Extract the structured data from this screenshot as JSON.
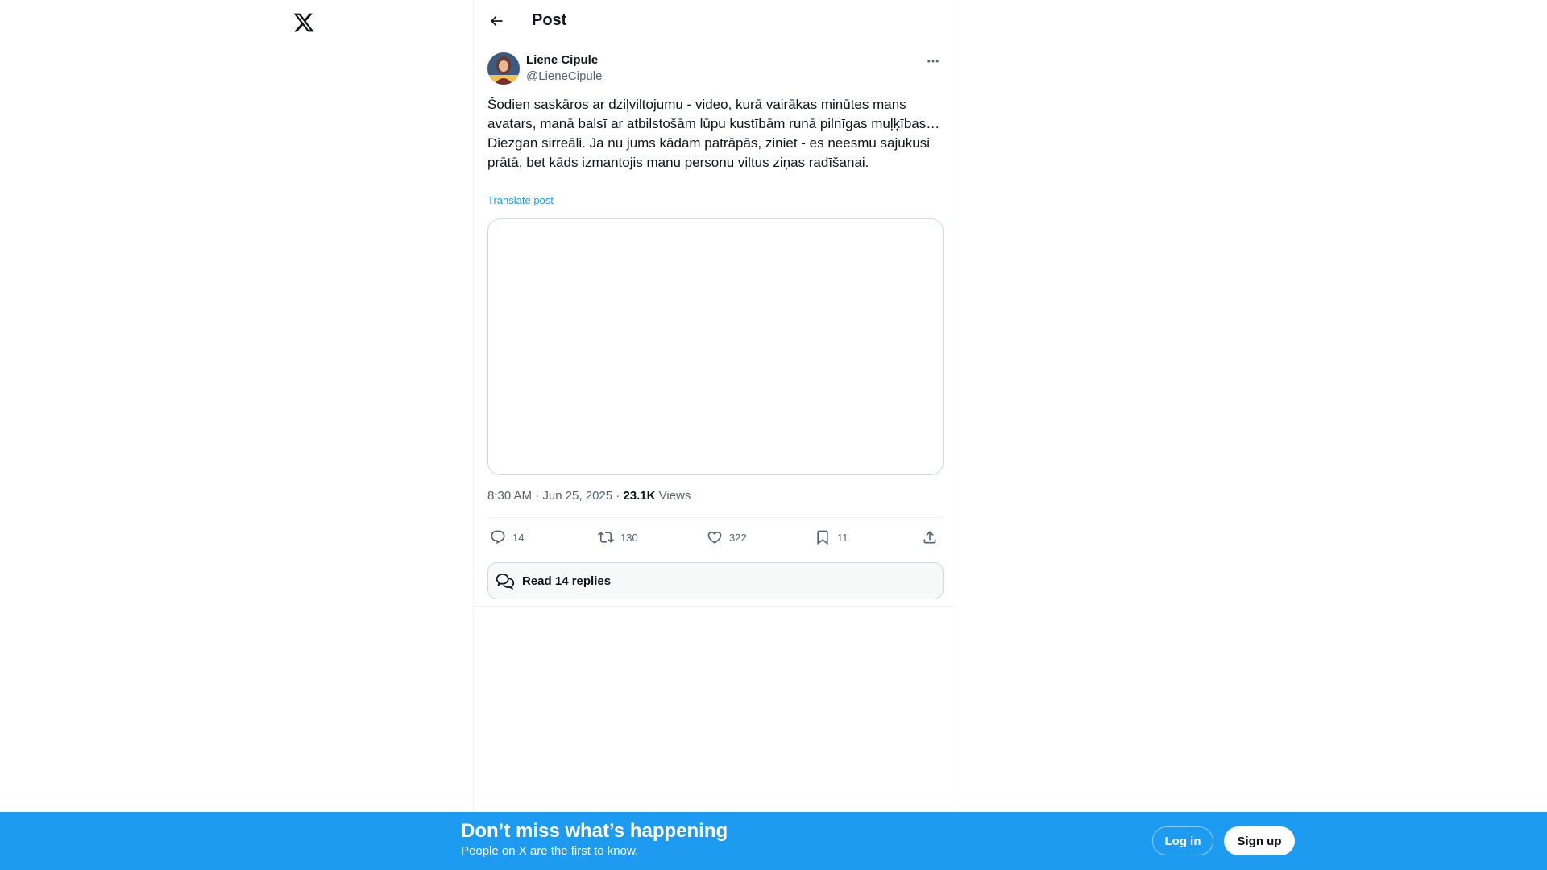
{
  "app": {
    "logo": "x-logo"
  },
  "header": {
    "title": "Post",
    "back_icon": "arrow-left-icon"
  },
  "post": {
    "author_name": "Liene Cipule",
    "author_handle": "@LieneCipule",
    "text": "Šodien saskāros ar dziļviltojumu - video, kurā vairākas minūtes mans avatars, manā balsī ar atbilstošām lūpu kustībām runā pilnīgas muļķības… Diezgan sirreāli. Ja nu jums kādam patrāpās, ziniet - es neesmu sajukusi prātā, bet kāds izmantojis manu personu viltus ziņas radīšanai.",
    "translate_label": "Translate post",
    "time": "8:30 AM · Jun 25, 2025 · ",
    "views_count": "23.1K",
    "views_label": " Views"
  },
  "actions": {
    "replies": "14",
    "reposts": "130",
    "likes": "322",
    "bookmarks": "11"
  },
  "read_replies_label": "Read 14 replies",
  "banner": {
    "title": "Don’t miss what’s happening",
    "subtitle": "People on X are the first to know.",
    "login_label": "Log in",
    "signup_label": "Sign up"
  },
  "colors": {
    "accent": "#1d9bf0",
    "text": "#0f1419",
    "muted": "#536471",
    "border": "#cfd9de"
  }
}
